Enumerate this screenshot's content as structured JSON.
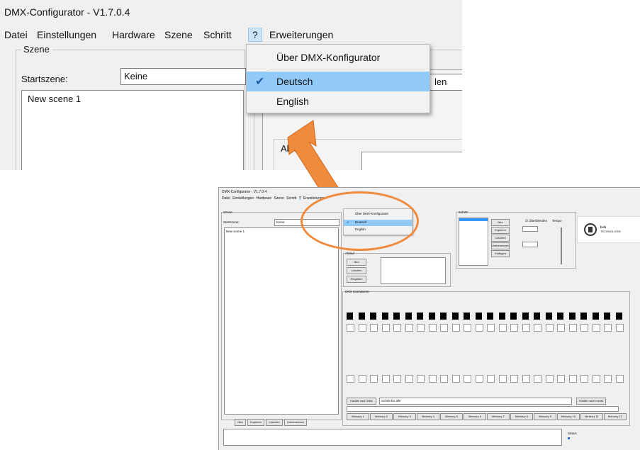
{
  "window": {
    "title": "DMX-Configurator - V1.7.0.4"
  },
  "menubar": {
    "items": [
      "Datei",
      "Einstellungen",
      "Hardware",
      "Szene",
      "Schritt",
      "?",
      "Erweiterungen"
    ],
    "active_index": 5
  },
  "help_menu": {
    "items": [
      {
        "label": "Über DMX-Konfigurator",
        "checked": false
      },
      {
        "label": "Deutsch",
        "checked": true
      },
      {
        "label": "English",
        "checked": false
      }
    ]
  },
  "scene_group": {
    "title": "Szene",
    "start_label": "Startszene:",
    "start_value": "Keine",
    "list_items": [
      "New scene 1"
    ]
  },
  "right_group": {
    "partial_label": "len",
    "section_label": "Ablauf"
  },
  "small_window": {
    "scene_buttons": [
      "Neu",
      "Kopieren",
      "Löschen",
      "Umbenennen"
    ],
    "ablauf_label": "Ablauf",
    "ablauf_buttons": [
      "Neu",
      "Löschen",
      "Eingaben"
    ],
    "steps_label": "Schritt",
    "step_buttons": [
      "Neu",
      "Kopieren",
      "Löschen",
      "Umbenennen",
      "Einfügen"
    ],
    "checkbox_label": "Überblenden",
    "tempo_label": "Tempo",
    "dmx_label": "DMX Kanalwerte",
    "footer_buttons": [
      "Kanäle nach links",
      "Kanäle nach rechts"
    ],
    "channel_select": "Schritt für alle",
    "memory_buttons": [
      "Memory 1",
      "Memory 2",
      "Memory 3",
      "Memory 4",
      "Memory 5",
      "Memory 6",
      "Memory 7",
      "Memory 8",
      "Memory 9",
      "Memory 10",
      "Memory 11",
      "Memory 12"
    ],
    "status_label": "Status",
    "logo_text": "b+b",
    "logo_sub": "TECHNOLOGIE"
  },
  "colors": {
    "highlight": "#91c9f7",
    "arrow": "#f08a3c",
    "menu_active": "#cce4f7"
  }
}
